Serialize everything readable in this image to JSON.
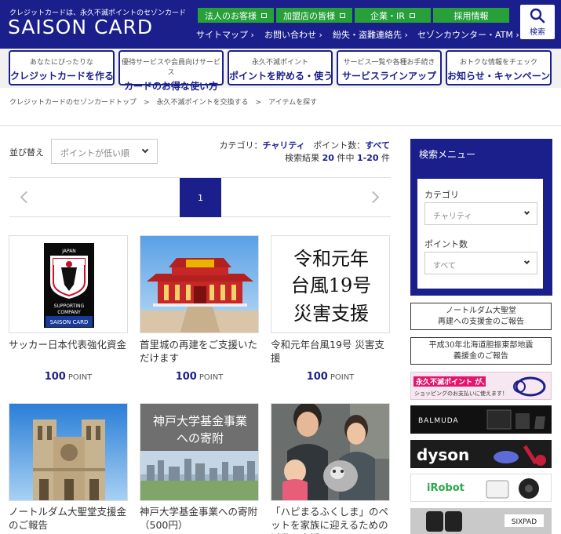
{
  "header": {
    "tagline": "クレジットカードは、永久不滅ポイントのセゾンカード",
    "logo": "SAISON CARD",
    "green_buttons": [
      "法人のお客様",
      "加盟店の皆様",
      "企業・IR",
      "採用情報"
    ],
    "nav": [
      "サイトマップ ›",
      "お問い合わせ ›",
      "紛失・盗難連絡先 ›",
      "セゾンカウンター・ATM ›"
    ],
    "search_label": "検索"
  },
  "banners": [
    {
      "small": "あなたにぴったりな",
      "big": "クレジットカードを作る"
    },
    {
      "small": "優待サービスや会員向けサービス",
      "big": "カードのお得な使い方"
    },
    {
      "small": "永久不滅ポイント",
      "big": "ポイントを貯める・使う"
    },
    {
      "small": "サービス一覧や各種お手続き",
      "big": "サービスラインアップ"
    },
    {
      "small": "おトクな情報をチェック",
      "big": "お知らせ・キャンペーン"
    }
  ],
  "breadcrumb": "クレジットカードのセゾンカードトップ　>　永久不滅ポイントを交換する　>　アイテムを探す",
  "sort": {
    "label": "並び替え",
    "value": "ポイントが低い順"
  },
  "filters": {
    "category_label": "カテゴリ：",
    "category_value": "チャリティ",
    "points_label": "ポイント数：",
    "points_value": "すべて",
    "result_prefix": "検索結果",
    "result_total": "20",
    "result_mid": "件中",
    "result_range": "1-20",
    "result_suffix": "件"
  },
  "pager": {
    "current": "1"
  },
  "cards": [
    {
      "title": "サッカー日本代表強化資金",
      "points": "100",
      "unit": "POINT"
    },
    {
      "title": "首里城の再建をご支援いただけます",
      "points": "100",
      "unit": "POINT"
    },
    {
      "title": "令和元年台風19号 災害支援",
      "points": "100",
      "unit": "POINT"
    },
    {
      "title": "ノートルダム大聖堂支援金のご報告",
      "points": "",
      "unit": ""
    },
    {
      "title": "神戸大学基金事業への寄附（500円）",
      "points": "",
      "unit": ""
    },
    {
      "title": "「ハピまるふくしま」のペットを家族に迎えるための活動を支援しよう",
      "points": "",
      "unit": ""
    }
  ],
  "card_images": {
    "jfa_top": "JAPAN",
    "jfa_bottom1": "SUPPORTING",
    "jfa_bottom2": "COMPANY",
    "jfa_saison": "SAISON CARD",
    "typhoon_lines": [
      "令和元年",
      "台風19号",
      "災害支援"
    ],
    "kobe_lines": [
      "神戸大学基金事業",
      "への寄附"
    ]
  },
  "sidebar": {
    "title": "検索メニュー",
    "category_label": "カテゴリ",
    "category_value": "チャリティ",
    "points_label": "ポイント数",
    "points_value": "すべて",
    "banners": [
      {
        "line1": "ノートルダム大聖堂",
        "line2": "再建への支援金のご報告"
      },
      {
        "line1": "平成30年北海道胆振東部地震",
        "line2": "義援金のご報告"
      }
    ],
    "ads": {
      "saison_top": "永久不滅ポイント が、",
      "saison_bottom": "ショッピングのお支払いに使えます！",
      "balmuda": "BALMUDA",
      "dyson": "dyson",
      "irobot": "iRobot",
      "sixpad": "SIXPAD"
    }
  },
  "colors": {
    "brand": "#1a1f8c",
    "green": "#27a03a"
  }
}
